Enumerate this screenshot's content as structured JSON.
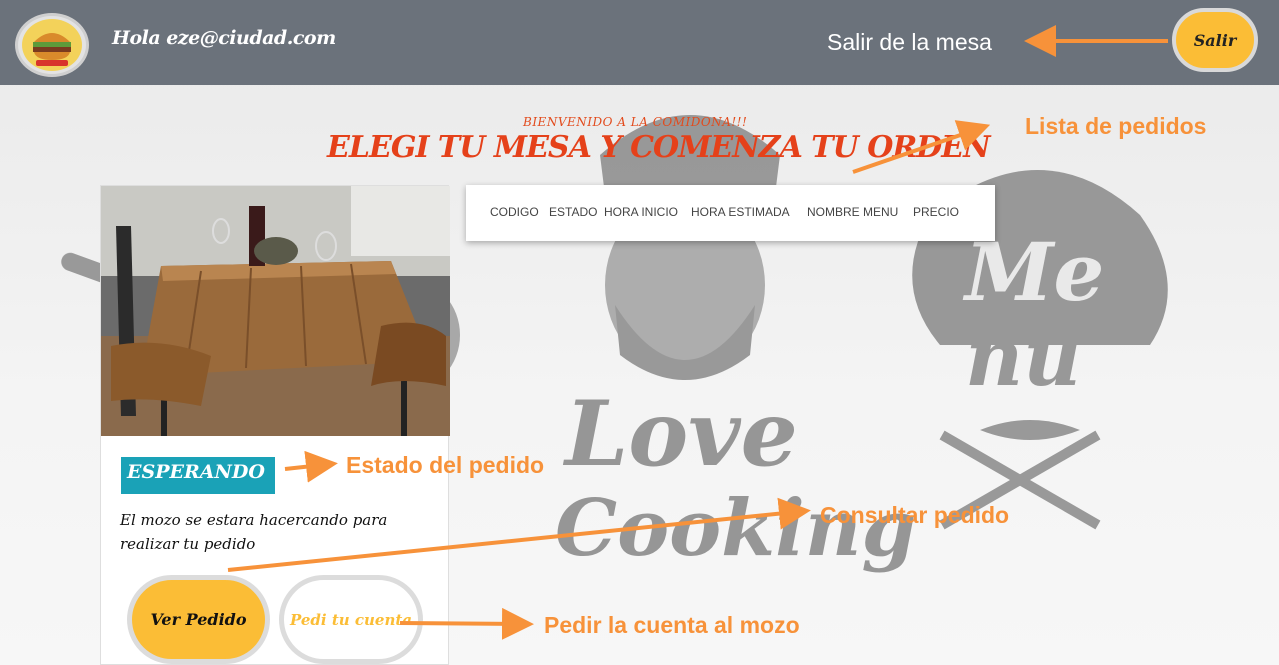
{
  "header": {
    "greeting": "Hola eze@ciudad.com",
    "leave_table": "Salir de la mesa",
    "logout_label": "Salir"
  },
  "hero": {
    "welcome": "BIENVENIDO A LA COMIDONA!!!",
    "headline": "ELEGI TU MESA Y COMENZA TU ORDEN"
  },
  "table_card": {
    "status": "ESPERANDO",
    "message": "El mozo se estara hacercando para realizar tu pedido",
    "view_order_label": "Ver Pedido",
    "ask_bill_label": "Pedi tu cuenta"
  },
  "orders_table": {
    "columns": [
      "CODIGO",
      "ESTADO",
      "HORA INICIO",
      "HORA ESTIMADA",
      "NOMBRE MENU",
      "PRECIO"
    ]
  },
  "annotations": {
    "orders_list": "Lista de pedidos",
    "order_status": "Estado del pedido",
    "check_order": "Consultar pedido",
    "ask_bill": "Pedir la cuenta al mozo"
  },
  "colors": {
    "topbar": "#6b727b",
    "accent_yellow": "#fbbd36",
    "status_teal": "#1aa2b7",
    "headline_red": "#e5411a",
    "annotation_orange": "#f7923a"
  }
}
